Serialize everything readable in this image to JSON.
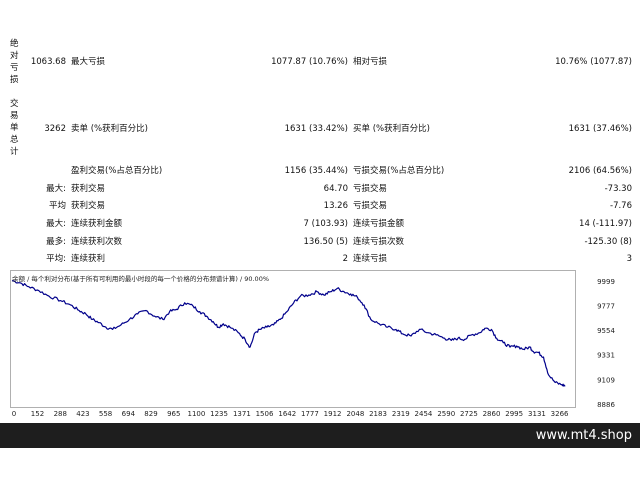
{
  "sections": {
    "absolute_drawdown_label": "绝对亏损",
    "trades_summary_label": "交易单总计"
  },
  "row1": {
    "abs_value": "1063.68",
    "max_dd_label": "最大亏损",
    "max_dd_value": "1077.87 (10.76%)",
    "rel_dd_label": "相对亏损",
    "rel_dd_value": "10.76% (1077.87)"
  },
  "row2": {
    "total_trades": "3262",
    "short_label": "卖单 (%获利百分比)",
    "short_value": "1631 (33.42%)",
    "long_label": "买单 (%获利百分比)",
    "long_value": "1631 (37.46%)"
  },
  "row3": {
    "profit_label": "盈利交易(%占总百分比)",
    "profit_value": "1156 (35.44%)",
    "loss_label": "亏损交易(%占总百分比)",
    "loss_value": "2106 (64.56%)"
  },
  "row4": {
    "prefix": "最大:",
    "profit_label": "获利交易",
    "profit_value": "64.70",
    "loss_label": "亏损交易",
    "loss_value": "-73.30"
  },
  "row5": {
    "prefix": "平均",
    "profit_label": "获利交易",
    "profit_value": "13.26",
    "loss_label": "亏损交易",
    "loss_value": "-7.76"
  },
  "row6": {
    "prefix": "最大:",
    "profit_label": "连续获利金额",
    "profit_value": "7 (103.93)",
    "loss_label": "连续亏损金额",
    "loss_value": "14 (-111.97)"
  },
  "row7": {
    "prefix": "最多:",
    "profit_label": "连续获利次数",
    "profit_value": "136.50 (5)",
    "loss_label": "连续亏损次数",
    "loss_value": "-125.30 (8)"
  },
  "row8": {
    "prefix": "平均:",
    "profit_label": "连续获利",
    "profit_value": "2",
    "loss_label": "连续亏损",
    "loss_value": "3"
  },
  "chart_title": "余额 / 每个利对分布(基于所有可利用的最小时段的每一个价格的分布频谱计算) / 90.00%",
  "footer": {
    "site": "www.mt4.shop"
  },
  "colors": {
    "line": "#00008b",
    "footer_bg": "#1e1e1e"
  },
  "chart_data": {
    "type": "line",
    "title": "余额 / 每个利对分布(基于所有可利用的最小时段的每一个价格的分布频谱计算) / 90.00%",
    "xlabel": "",
    "ylabel": "",
    "x_ticks": [
      "0",
      "152",
      "288",
      "423",
      "558",
      "694",
      "829",
      "965",
      "1100",
      "1235",
      "1371",
      "1506",
      "1642",
      "1777",
      "1912",
      "2048",
      "2183",
      "2319",
      "2454",
      "2590",
      "2725",
      "2860",
      "2995",
      "3131",
      "3266"
    ],
    "y_ticks": [
      "9999",
      "9777",
      "9554",
      "9331",
      "9109",
      "8886"
    ],
    "xlim": [
      0,
      3340
    ],
    "ylim": [
      8886,
      10060
    ],
    "series": [
      {
        "x": [
          0,
          50,
          100,
          160,
          220,
          290,
          350,
          400,
          440,
          480,
          520,
          560,
          600,
          650,
          700,
          750,
          800,
          850,
          900,
          940,
          980,
          1030,
          1080,
          1120,
          1160,
          1200,
          1230,
          1260,
          1300,
          1350,
          1390,
          1420,
          1450,
          1480,
          1520,
          1560,
          1600,
          1640,
          1680,
          1720,
          1770,
          1820,
          1860,
          1900,
          1940,
          1980,
          2020,
          2060,
          2100,
          2140,
          2190,
          2240,
          2290,
          2330,
          2380,
          2430,
          2480,
          2530,
          2580,
          2620,
          2660,
          2700,
          2740,
          2790,
          2820,
          2860,
          2890,
          2930,
          2970,
          3010,
          3050,
          3090,
          3110,
          3140,
          3170,
          3200,
          3240,
          3280,
          3300
        ],
        "y": [
          10000,
          9980,
          9945,
          9910,
          9860,
          9820,
          9780,
          9730,
          9700,
          9650,
          9620,
          9580,
          9560,
          9600,
          9650,
          9700,
          9730,
          9680,
          9650,
          9720,
          9740,
          9800,
          9770,
          9720,
          9680,
          9630,
          9580,
          9610,
          9580,
          9530,
          9470,
          9400,
          9530,
          9560,
          9580,
          9600,
          9650,
          9720,
          9800,
          9860,
          9870,
          9900,
          9870,
          9900,
          9930,
          9900,
          9880,
          9850,
          9780,
          9650,
          9610,
          9580,
          9560,
          9520,
          9500,
          9560,
          9530,
          9510,
          9480,
          9460,
          9480,
          9470,
          9510,
          9530,
          9570,
          9560,
          9480,
          9440,
          9400,
          9410,
          9380,
          9400,
          9360,
          9350,
          9310,
          9150,
          9080,
          9060,
          9050
        ]
      }
    ]
  }
}
